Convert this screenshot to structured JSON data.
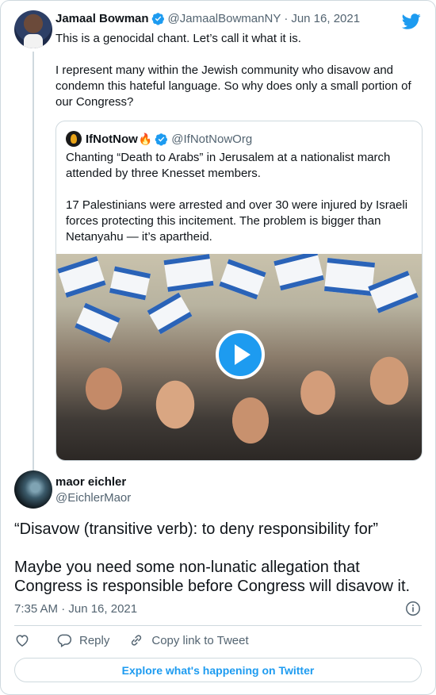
{
  "parent_tweet": {
    "author_name": "Jamaal Bowman",
    "handle": "@JamaalBowmanNY",
    "separator": "·",
    "date": "Jun 16, 2021",
    "paragraphs": [
      "This is a genocidal chant. Let’s call it what it is.",
      "I represent many within the Jewish community who disavow and condemn this hateful language. So why does only a small portion of our Congress?"
    ]
  },
  "quoted_tweet": {
    "author_name": "IfNotNow",
    "handle": "@IfNotNowOrg",
    "paragraphs": [
      "Chanting “Death to Arabs” in Jerusalem at a nationalist march attended by three Knesset members.",
      "17 Palestinians were arrested and over 30 were injured by Israeli forces protecting this incitement. The problem is bigger than Netanyahu — it’s apartheid."
    ]
  },
  "reply_tweet": {
    "author_name": "maor eichler",
    "handle": "@EichlerMaor",
    "paragraphs": [
      "“Disavow (transitive verb): to deny responsibility for”",
      "Maybe you need some non-lunatic allegation that Congress is responsible before Congress will disavow it."
    ],
    "timestamp": "7:35 AM · Jun 16, 2021"
  },
  "actions": {
    "reply_label": "Reply",
    "copy_link_label": "Copy link to Tweet"
  },
  "explore_button": {
    "label": "Explore what's happening on Twitter"
  },
  "colors": {
    "accent": "#1d9bf0",
    "text_primary": "#0f1419",
    "text_secondary": "#536471",
    "border": "#cfd9de"
  },
  "icons": [
    "twitter-logo-icon",
    "verified-badge-icon",
    "play-icon",
    "info-icon",
    "heart-icon",
    "reply-icon",
    "link-icon"
  ]
}
